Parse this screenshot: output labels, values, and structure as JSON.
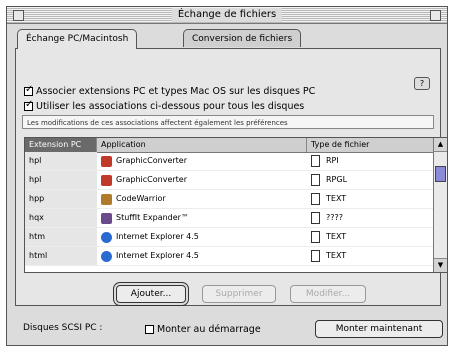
{
  "window": {
    "title": "Échange de fichiers"
  },
  "tabs": [
    {
      "label": "Échange PC/Macintosh",
      "active": true
    },
    {
      "label": "Conversion de fichiers",
      "active": false
    }
  ],
  "options": {
    "associate_label": "Associer extensions PC et types Mac OS sur les disques PC",
    "associate_checked": true,
    "use_assoc_label": "Utiliser les associations ci-dessous pour tous les disques",
    "use_assoc_checked": true,
    "note": "Les modifications de ces associations affectent également les préférences"
  },
  "table": {
    "headers": {
      "ext": "Extension PC",
      "app": "Application",
      "type": "Type de fichier"
    },
    "rows": [
      {
        "ext": "hpl",
        "app": "GraphicConverter",
        "type": "RPI",
        "icon_color": "#c0392b"
      },
      {
        "ext": "hpl",
        "app": "GraphicConverter",
        "type": "RPGL",
        "icon_color": "#c0392b"
      },
      {
        "ext": "hpp",
        "app": "CodeWarrior",
        "type": "TEXT",
        "icon_color": "#b07a2a"
      },
      {
        "ext": "hqx",
        "app": "StuffIt Expander™",
        "type": "????",
        "icon_color": "#6a4a8a"
      },
      {
        "ext": "htm",
        "app": "Internet Explorer 4.5",
        "type": "TEXT",
        "icon_color": "#2a6bd1"
      },
      {
        "ext": "html",
        "app": "Internet Explorer 4.5",
        "type": "TEXT",
        "icon_color": "#2a6bd1"
      }
    ]
  },
  "buttons": {
    "add": "Ajouter...",
    "delete": "Supprimer",
    "modify": "Modifier..."
  },
  "scsi": {
    "label": "Disques SCSI PC :",
    "mount_startup_label": "Monter au démarrage",
    "mount_startup_checked": false,
    "mount_now": "Monter maintenant"
  }
}
